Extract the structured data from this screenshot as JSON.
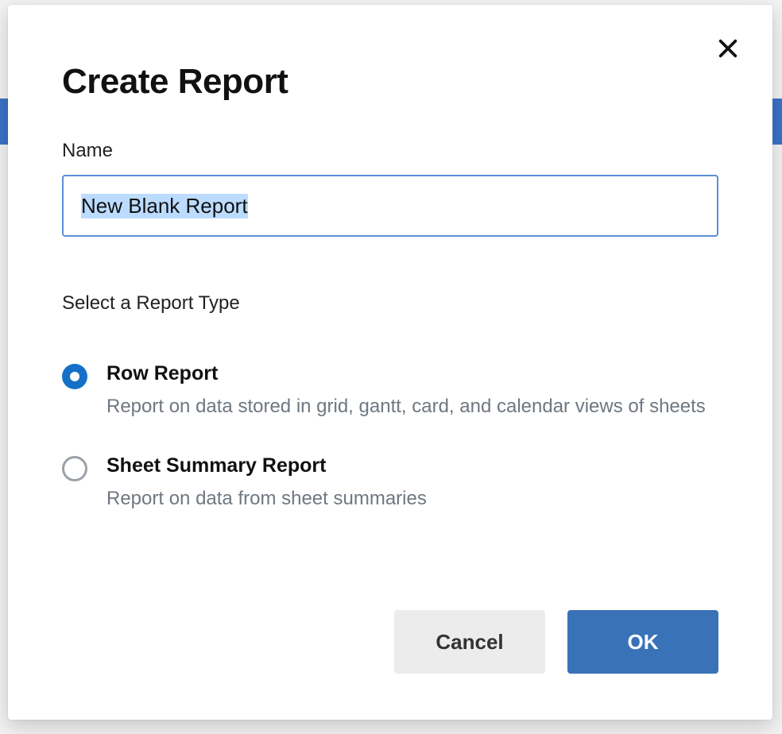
{
  "dialog": {
    "title": "Create Report",
    "name_label": "Name",
    "name_value": "New Blank Report",
    "type_section_label": "Select a Report Type",
    "options": [
      {
        "title": "Row Report",
        "description": "Report on data stored in grid, gantt, card, and calendar views of sheets",
        "selected": true
      },
      {
        "title": "Sheet Summary Report",
        "description": "Report on data from sheet summaries",
        "selected": false
      }
    ],
    "buttons": {
      "cancel": "Cancel",
      "ok": "OK"
    }
  }
}
